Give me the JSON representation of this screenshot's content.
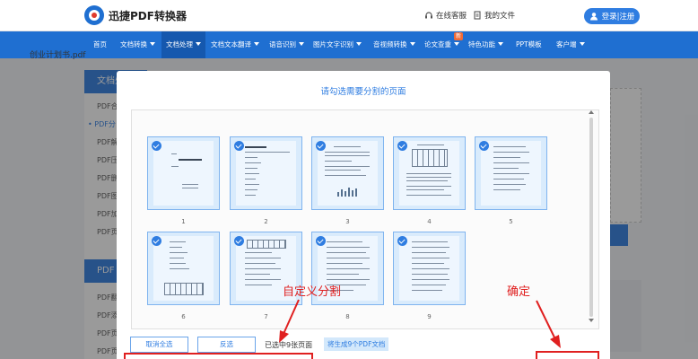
{
  "header": {
    "logo_text": "迅捷PDF转换器",
    "service_label": "在线客服",
    "files_label": "我的文件",
    "login_label": "登录|注册"
  },
  "nav": {
    "items": [
      {
        "label": "首页",
        "dropdown": false
      },
      {
        "label": "文档转换",
        "dropdown": true
      },
      {
        "label": "文档处理",
        "dropdown": true,
        "active": true
      },
      {
        "label": "文档文本翻译",
        "dropdown": true
      },
      {
        "label": "语音识别",
        "dropdown": true
      },
      {
        "label": "图片文字识别",
        "dropdown": true
      },
      {
        "label": "音视频转换",
        "dropdown": true
      },
      {
        "label": "论文查重",
        "dropdown": true
      },
      {
        "label": "特色功能",
        "dropdown": true
      },
      {
        "label": "PPT模板",
        "dropdown": false
      },
      {
        "label": "客户端",
        "dropdown": true
      }
    ],
    "badge": "新"
  },
  "sidebar": {
    "section1": "文档处",
    "items1": [
      "PDF合",
      "• PDF分",
      "PDF解",
      "PDF压",
      "PDF删",
      "PDF图",
      "PDF加",
      "PDF页"
    ],
    "section2": "PDF",
    "items2": [
      "PDF翻",
      "PDF添",
      "PDF页",
      "PDF页"
    ]
  },
  "modal": {
    "title": "请勾选需要分割的页面",
    "file_name": "创业计划书.pdf",
    "pages": [
      "1",
      "2",
      "3",
      "4",
      "5",
      "6",
      "7",
      "8",
      "9"
    ],
    "cancel_all_label": "取消全选",
    "invert_label": "反选",
    "status_text": "已选中9张页面",
    "generate_text": "将生成9个PDF文档"
  },
  "annotations": {
    "custom_split": "自定义分割",
    "confirm": "确定"
  },
  "colors": {
    "brand_blue": "#1f6fd1",
    "accent_blue": "#2f7de1",
    "annotation_red": "#e02020",
    "thumb_fill": "#d9ebfc"
  }
}
